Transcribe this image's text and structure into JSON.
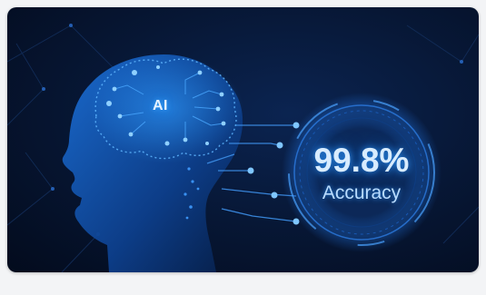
{
  "brain": {
    "label": "AI"
  },
  "metric": {
    "value": "99.8%",
    "label": "Accuracy"
  },
  "colors": {
    "background": "#071735",
    "accent": "#3fa9ff",
    "glow": "#1f7ee8"
  },
  "icons": [
    "ai-head-illustration",
    "circuit-brain-icon",
    "accuracy-ring-icon"
  ]
}
